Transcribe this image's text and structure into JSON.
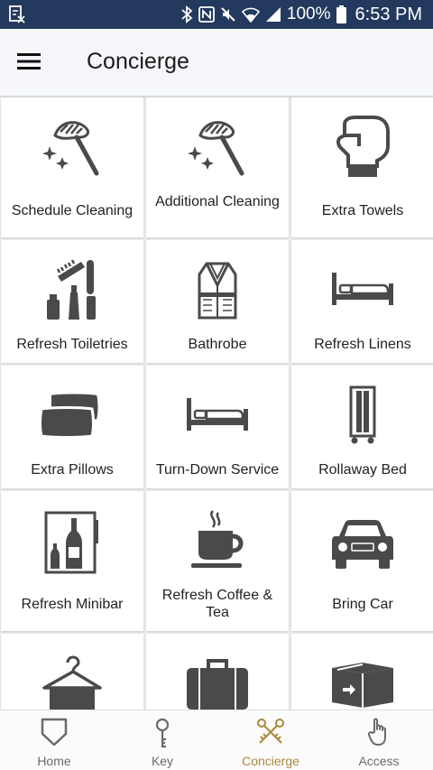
{
  "status_bar": {
    "battery": "100%",
    "time": "6:53 PM",
    "icons": [
      "notification-icon",
      "bluetooth-icon",
      "nfc-icon",
      "mute-icon",
      "wifi-icon",
      "signal-icon",
      "battery-icon"
    ]
  },
  "app_bar": {
    "title": "Concierge",
    "menu_icon": "hamburger-menu-icon"
  },
  "services": [
    {
      "label": "Schedule Cleaning",
      "icon": "duster-icon"
    },
    {
      "label": "Additional Cleaning",
      "icon": "duster-icon"
    },
    {
      "label": "Extra Towels",
      "icon": "towel-icon"
    },
    {
      "label": "Refresh Toiletries",
      "icon": "toiletries-icon"
    },
    {
      "label": "Bathrobe",
      "icon": "bathrobe-icon"
    },
    {
      "label": "Refresh Linens",
      "icon": "bed-icon"
    },
    {
      "label": "Extra Pillows",
      "icon": "pillows-icon"
    },
    {
      "label": "Turn-Down Service",
      "icon": "bed-icon"
    },
    {
      "label": "Rollaway Bed",
      "icon": "rollaway-bed-icon"
    },
    {
      "label": "Refresh Minibar",
      "icon": "minibar-icon"
    },
    {
      "label": "Refresh Coffee & Tea",
      "icon": "coffee-cup-icon"
    },
    {
      "label": "Bring Car",
      "icon": "car-icon"
    },
    {
      "label": "",
      "icon": "hanger-icon"
    },
    {
      "label": "",
      "icon": "suitcase-icon"
    },
    {
      "label": "",
      "icon": "package-icon"
    }
  ],
  "bottom_nav": {
    "active_color": "#a98a3c",
    "items": [
      {
        "label": "Home",
        "icon": "shield-home-icon"
      },
      {
        "label": "Key",
        "icon": "key-icon"
      },
      {
        "label": "Concierge",
        "icon": "crossed-keys-icon",
        "active": true
      },
      {
        "label": "Access",
        "icon": "hand-pointer-icon"
      }
    ]
  },
  "colors": {
    "status_bar": "#233a5e",
    "icon_dark": "#4a4a4a",
    "accent": "#a98a3c"
  }
}
